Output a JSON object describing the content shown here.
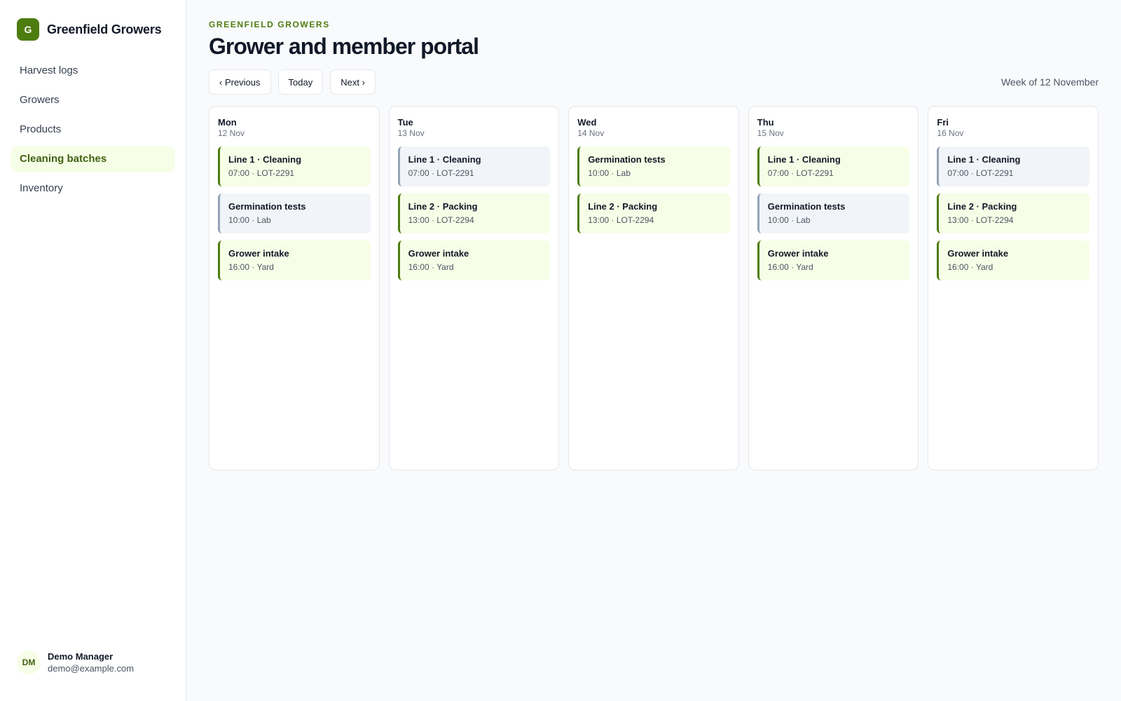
{
  "brand": {
    "logo_letter": "G",
    "name": "Greenfield Growers"
  },
  "nav": {
    "items": [
      {
        "label": "Harvest logs",
        "active": false
      },
      {
        "label": "Growers",
        "active": false
      },
      {
        "label": "Products",
        "active": false
      },
      {
        "label": "Cleaning batches",
        "active": true
      },
      {
        "label": "Inventory",
        "active": false
      }
    ]
  },
  "user": {
    "initials": "DM",
    "name": "Demo Manager",
    "email": "demo@example.com"
  },
  "header": {
    "eyebrow": "GREENFIELD GROWERS",
    "title": "Grower and member portal"
  },
  "toolbar": {
    "previous_label": "‹ Previous",
    "today_label": "Today",
    "next_label": "Next ›",
    "week_label": "Week of 12 November"
  },
  "colors": {
    "accent": "#4d7c0f",
    "accent_bg": "#f7fee7",
    "neutral_border": "#94a3b8",
    "neutral_bg": "#f1f5f9"
  },
  "days": [
    {
      "name": "Mon",
      "date": "12 Nov",
      "events": [
        {
          "title": "Line 1 · Cleaning",
          "meta": "07:00 · LOT-2291",
          "style": "green"
        },
        {
          "title": "Germination tests",
          "meta": "10:00 · Lab",
          "style": "gray"
        },
        {
          "title": "Grower intake",
          "meta": "16:00 · Yard",
          "style": "green"
        }
      ]
    },
    {
      "name": "Tue",
      "date": "13 Nov",
      "events": [
        {
          "title": "Line 1 · Cleaning",
          "meta": "07:00 · LOT-2291",
          "style": "gray"
        },
        {
          "title": "Line 2 · Packing",
          "meta": "13:00 · LOT-2294",
          "style": "green"
        },
        {
          "title": "Grower intake",
          "meta": "16:00 · Yard",
          "style": "green"
        }
      ]
    },
    {
      "name": "Wed",
      "date": "14 Nov",
      "events": [
        {
          "title": "Germination tests",
          "meta": "10:00 · Lab",
          "style": "green"
        },
        {
          "title": "Line 2 · Packing",
          "meta": "13:00 · LOT-2294",
          "style": "green"
        }
      ]
    },
    {
      "name": "Thu",
      "date": "15 Nov",
      "events": [
        {
          "title": "Line 1 · Cleaning",
          "meta": "07:00 · LOT-2291",
          "style": "green"
        },
        {
          "title": "Germination tests",
          "meta": "10:00 · Lab",
          "style": "gray"
        },
        {
          "title": "Grower intake",
          "meta": "16:00 · Yard",
          "style": "green"
        }
      ]
    },
    {
      "name": "Fri",
      "date": "16 Nov",
      "events": [
        {
          "title": "Line 1 · Cleaning",
          "meta": "07:00 · LOT-2291",
          "style": "gray"
        },
        {
          "title": "Line 2 · Packing",
          "meta": "13:00 · LOT-2294",
          "style": "green"
        },
        {
          "title": "Grower intake",
          "meta": "16:00 · Yard",
          "style": "green"
        }
      ]
    }
  ]
}
